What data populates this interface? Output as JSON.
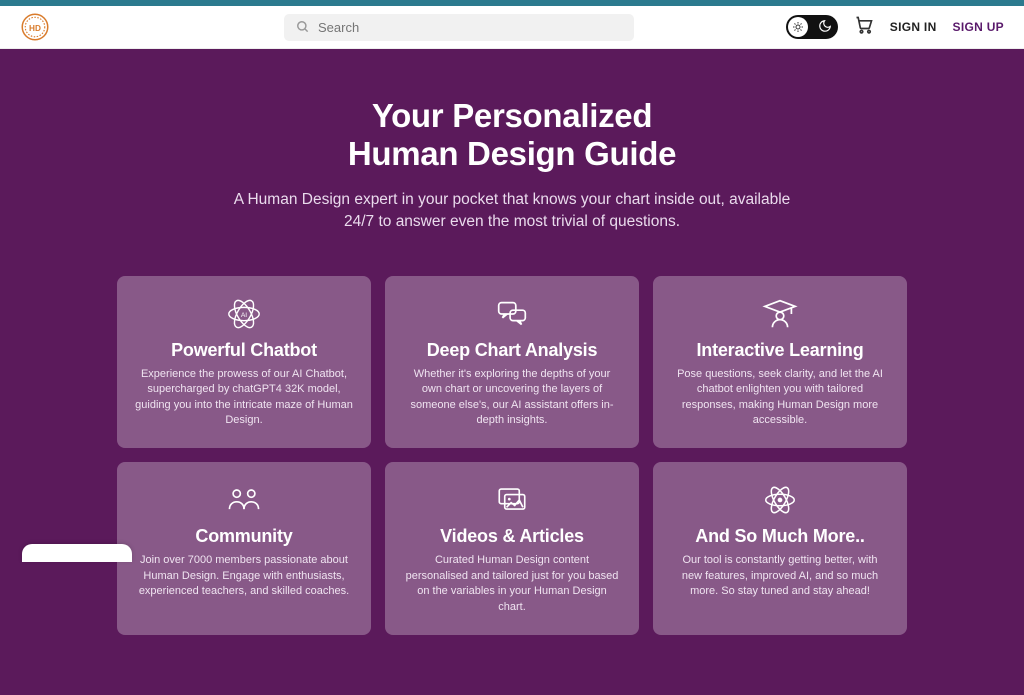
{
  "header": {
    "search_placeholder": "Search",
    "signin": "SIGN IN",
    "signup": "SIGN UP"
  },
  "hero": {
    "title_line1": "Your Personalized",
    "title_line2": "Human Design Guide",
    "subtitle": "A Human Design expert in your pocket that knows your chart inside out, available 24/7 to answer even the most trivial of questions."
  },
  "cards": [
    {
      "title": "Powerful Chatbot",
      "desc": "Experience the prowess of our AI Chatbot, supercharged by chatGPT4 32K model, guiding you into the intricate maze of Human Design."
    },
    {
      "title": "Deep Chart Analysis",
      "desc": "Whether it's exploring the depths of your own chart or uncovering the layers of someone else's, our AI assistant offers in-depth insights."
    },
    {
      "title": "Interactive Learning",
      "desc": "Pose questions, seek clarity, and let the AI chatbot enlighten you with tailored responses, making Human Design more accessible."
    },
    {
      "title": "Community",
      "desc": "Join over 7000 members passionate about Human Design. Engage with enthusiasts, experienced teachers, and skilled coaches."
    },
    {
      "title": "Videos & Articles",
      "desc": "Curated Human Design content personalised and tailored just for you based on the variables in your Human Design chart."
    },
    {
      "title": "And So Much More..",
      "desc": "Our tool is constantly getting better, with new features, improved AI, and so much more. So stay tuned and stay ahead!"
    }
  ]
}
